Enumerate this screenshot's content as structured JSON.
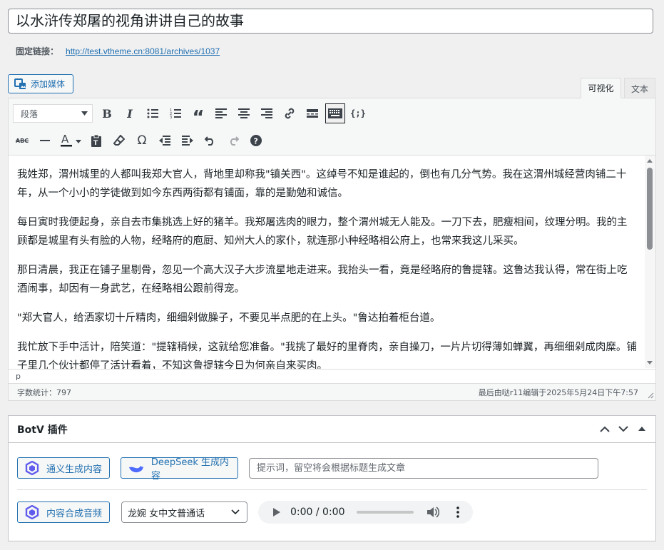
{
  "post": {
    "title": "以水浒传郑屠的视角讲讲自己的故事",
    "permalink_label": "固定链接：",
    "permalink_url": "http://test.vtheme.cn:8081/archives/1037"
  },
  "editor": {
    "add_media_label": "添加媒体",
    "tabs": {
      "visual": "可视化",
      "text": "文本"
    },
    "format_select": "段落",
    "paragraphs": [
      "我姓郑，渭州城里的人都叫我郑大官人，背地里却称我\"镇关西\"。这绰号不知是谁起的，倒也有几分气势。我在这渭州城经营肉铺二十年，从一个小小的学徒做到如今东西两街都有铺面，靠的是勤勉和诚信。",
      "每日寅时我便起身，亲自去市集挑选上好的猪羊。我郑屠选肉的眼力，整个渭州城无人能及。一刀下去，肥瘦相间，纹理分明。我的主顾都是城里有头有脸的人物，经略府的庖厨、知州大人的家仆，就连那小种经略相公府上，也常来我这儿采买。",
      "那日清晨，我正在铺子里剔骨，忽见一个高大汉子大步流星地走进来。我抬头一看，竟是经略府的鲁提辖。这鲁达我认得，常在街上吃酒闹事，却因有一身武艺，在经略相公跟前得宠。",
      "\"郑大官人，给洒家切十斤精肉，细细剁做臊子，不要见半点肥的在上头。\"鲁达拍着柜台道。",
      "我忙放下手中活计，陪笑道：\"提辖稍候，这就给您准备。\"我挑了最好的里脊肉，亲自操刀，一片片切得薄如蝉翼，再细细剁成肉糜。铺子里几个伙计都停了活计看着，不知这鲁提辖今日为何亲自来买肉。"
    ],
    "path": "p",
    "word_count": "字数统计：797",
    "last_edited": "最后由哒r11编辑于2025年5月24日下午7:57"
  },
  "plugin": {
    "title": "BotV 插件",
    "tongyi_button": "通义生成内容",
    "deepseek_button": "DeepSeek 生成内容",
    "prompt_placeholder": "提示词，留空将会根据标题生成文章",
    "audio_button": "内容合成音频",
    "voice_select": "龙婉 女中文普通话",
    "audio_time": "0:00 / 0:00"
  },
  "colors": {
    "accent": "#2271b1",
    "border": "#dcdcde",
    "background": "#f0f0f1"
  }
}
